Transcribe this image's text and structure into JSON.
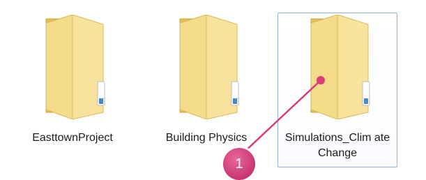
{
  "folders": [
    {
      "name": "EasttownProject",
      "icon": "folder-icon",
      "selected": false
    },
    {
      "name": "Building Physics",
      "icon": "folder-icon",
      "selected": false
    },
    {
      "name": "Simulations_ClimateChange",
      "display": "Simulations_Clim ateChange",
      "icon": "folder-icon",
      "selected": true
    }
  ],
  "annotation": {
    "step_number": "1",
    "color": "#d93c78"
  },
  "colors": {
    "folder_back": "#e8c862",
    "folder_front": "#f6df8f",
    "selection_border": "#8cb3dd"
  }
}
